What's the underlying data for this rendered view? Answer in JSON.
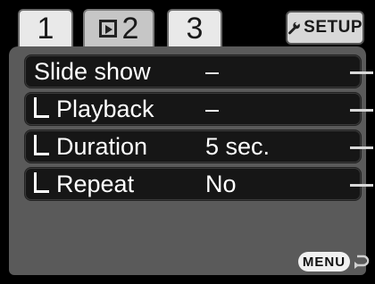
{
  "tabs": [
    {
      "label": "1"
    },
    {
      "label": "2"
    },
    {
      "label": "3"
    },
    {
      "label": "SETUP"
    }
  ],
  "menu": {
    "rows": [
      {
        "label": "Slide show",
        "value": "–"
      },
      {
        "label": "Playback",
        "value": "–"
      },
      {
        "label": "Duration",
        "value": "5 sec."
      },
      {
        "label": "Repeat",
        "value": "No"
      }
    ]
  },
  "footer": {
    "menu_label": "MENU"
  },
  "icons": {
    "playback_tab": "playback-frame-icon",
    "setup": "wrench-icon",
    "sub_item": "sub-item-corner-icon",
    "back": "return-arrow-icon"
  },
  "colors": {
    "panel": "#5a5a5a",
    "row": "#161616",
    "active_tab": "#c6c6c6",
    "inactive_tab": "#e9e9e9"
  }
}
